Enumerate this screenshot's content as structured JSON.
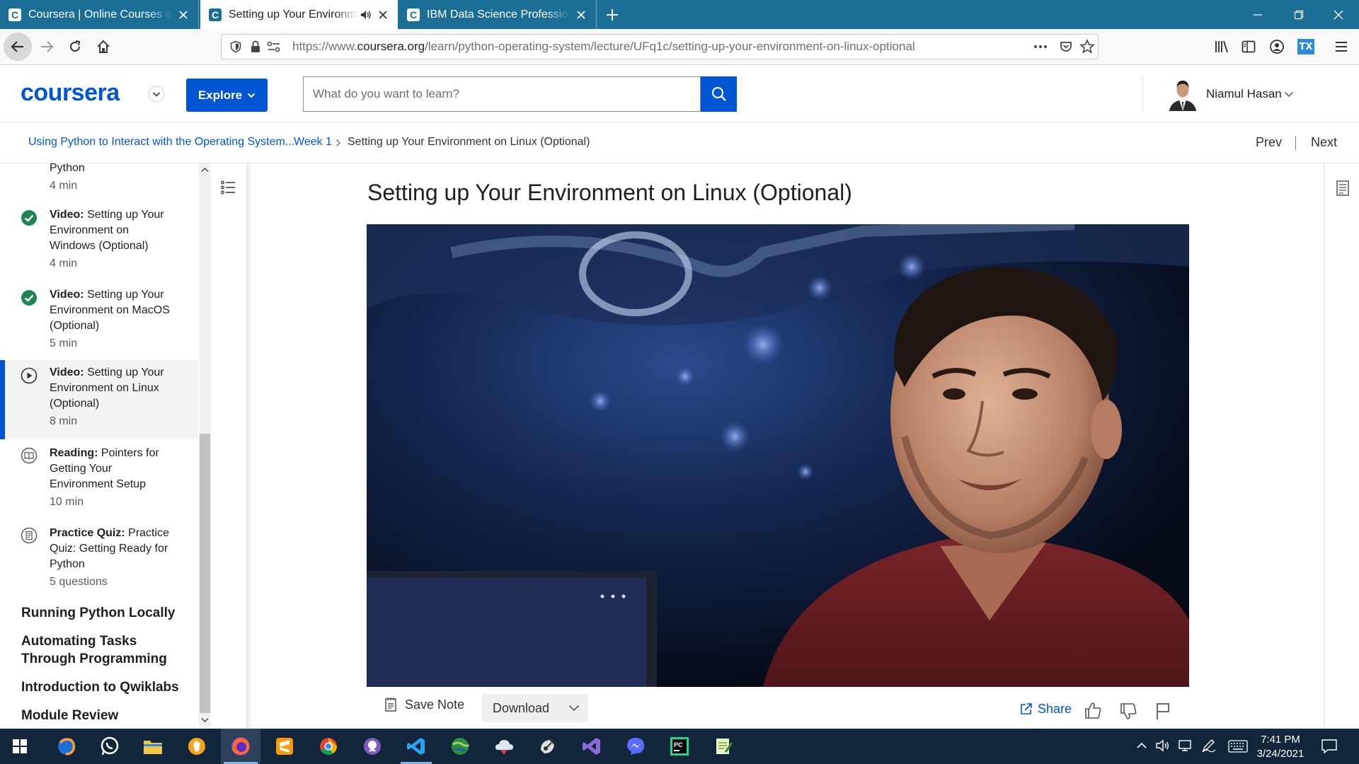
{
  "browser": {
    "tabs": [
      {
        "title": "Coursera | Online Courses & Credentials",
        "favicon": "C"
      },
      {
        "title": "Setting up Your Environment on Linux (Optional)",
        "favicon": "C"
      },
      {
        "title": "IBM Data Science Professional Certificate",
        "favicon": "C"
      }
    ],
    "url_prefix": "https://www.",
    "url_domain": "coursera.org",
    "url_path": "/learn/python-operating-system/lecture/UFq1c/setting-up-your-environment-on-linux-optional",
    "colors": {
      "tabbar": "#1b6f96",
      "navbar": "#f9f9fa"
    }
  },
  "header": {
    "logo": "coursera",
    "explore_label": "Explore",
    "search_placeholder": "What do you want to learn?",
    "user_name": "Niamul Hasan",
    "brand_color": "#0056d2"
  },
  "breadcrumb": {
    "course": "Using Python to Interact with the Operating System...",
    "week": "Week 1",
    "current": "Setting up Your Environment on Linux (Optional)",
    "prev": "Prev",
    "next": "Next"
  },
  "sidebar": {
    "partial_item": {
      "title": "Python",
      "duration": "4 min"
    },
    "items": [
      {
        "type": "Video:",
        "title": "Setting up Your Environment on Windows (Optional)",
        "duration": "4 min",
        "status": "completed",
        "icon": "check-circle-icon"
      },
      {
        "type": "Video:",
        "title": "Setting up Your Environment on MacOS (Optional)",
        "duration": "5 min",
        "status": "completed",
        "icon": "check-circle-icon"
      },
      {
        "type": "Video:",
        "title": "Setting up Your Environment on Linux (Optional)",
        "duration": "8 min",
        "status": "current",
        "icon": "play-circle-icon"
      },
      {
        "type": "Reading:",
        "title": "Pointers for Getting Your Environment Setup",
        "duration": "10 min",
        "status": "todo",
        "icon": "book-icon"
      },
      {
        "type": "Practice Quiz:",
        "title": "Practice Quiz: Getting Ready for Python",
        "duration": "5 questions",
        "status": "todo",
        "icon": "quiz-icon"
      }
    ],
    "sections": [
      "Running Python Locally",
      "Automating Tasks Through Programming",
      "Introduction to Qwiklabs",
      "Module Review"
    ],
    "colors": {
      "complete": "#1f8354",
      "current_bg": "#f3f3f3",
      "current_bar": "#0056d2"
    }
  },
  "main": {
    "title": "Setting up Your Environment on Linux (Optional)",
    "save_note": "Save Note",
    "download": "Download",
    "share": "Share"
  },
  "taskbar": {
    "icons": [
      "windows-start-icon",
      "firefox-dev-icon",
      "whatsapp-icon",
      "file-explorer-icon",
      "brave-icon",
      "firefox-icon",
      "sublime-icon",
      "chrome-icon",
      "github-desktop-icon",
      "vscode-icon",
      "earth-icon",
      "cloud-icon",
      "satellite-icon",
      "visual-studio-icon",
      "messenger-icon",
      "pycharm-icon",
      "notepad-icon"
    ],
    "time": "7:41 PM",
    "date": "3/24/2021"
  }
}
